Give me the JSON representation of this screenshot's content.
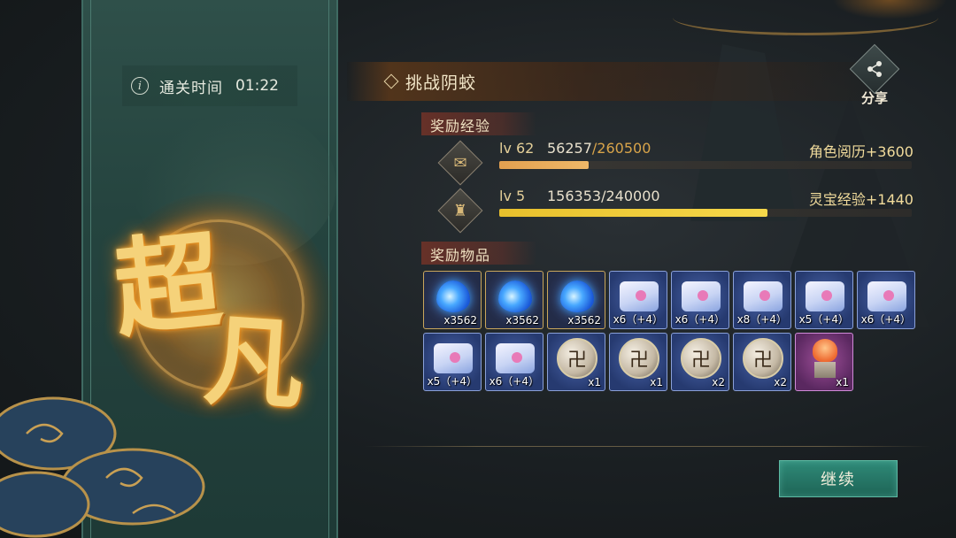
{
  "stage": {
    "time_label": "通关时间",
    "time_value": "01:22",
    "grade_char1": "超",
    "grade_char2": "凡",
    "title": "挑战阴蛟"
  },
  "share": {
    "label": "分享",
    "icon": "share-icon"
  },
  "exp_section": {
    "label": "奖励经验",
    "rows": [
      {
        "icon": "scroll-icon",
        "level": "lv 62",
        "current": "56257",
        "max": "/260500",
        "progress": 0.216,
        "bonus": "角色阅历+3600"
      },
      {
        "icon": "bell-icon",
        "level": "lv 5",
        "current": "156353",
        "max": "/240000",
        "progress": 0.651,
        "bonus": "灵宝经验+1440"
      }
    ]
  },
  "items_section": {
    "label": "奖励物品",
    "items": [
      {
        "type": "spirit-flame",
        "quality": "gold",
        "qty": "x3562"
      },
      {
        "type": "spirit-flame",
        "quality": "gold",
        "qty": "x3562"
      },
      {
        "type": "spirit-flame",
        "quality": "gold",
        "qty": "x3562"
      },
      {
        "type": "scroll",
        "quality": "blue",
        "qty": "x6（+4）"
      },
      {
        "type": "scroll",
        "quality": "blue",
        "qty": "x6（+4）"
      },
      {
        "type": "scroll",
        "quality": "blue",
        "qty": "x8（+4）"
      },
      {
        "type": "scroll",
        "quality": "blue",
        "qty": "x5（+4）"
      },
      {
        "type": "scroll",
        "quality": "blue",
        "qty": "x6（+4）"
      },
      {
        "type": "scroll",
        "quality": "blue",
        "qty": "x5（+4）"
      },
      {
        "type": "scroll",
        "quality": "blue",
        "qty": "x6（+4）"
      },
      {
        "type": "orb",
        "quality": "blue",
        "qty": "x1"
      },
      {
        "type": "orb",
        "quality": "blue",
        "qty": "x1"
      },
      {
        "type": "orb",
        "quality": "blue",
        "qty": "x2"
      },
      {
        "type": "orb",
        "quality": "blue",
        "qty": "x2"
      },
      {
        "type": "statue",
        "quality": "purple",
        "qty": "x1"
      }
    ]
  },
  "continue_button": {
    "label": "继续"
  },
  "colors": {
    "accent_teal": "#2f8a78",
    "gold_text": "#f5d27a",
    "exp_bar_1": "#e2a050",
    "exp_bar_2": "#e8c02c"
  }
}
